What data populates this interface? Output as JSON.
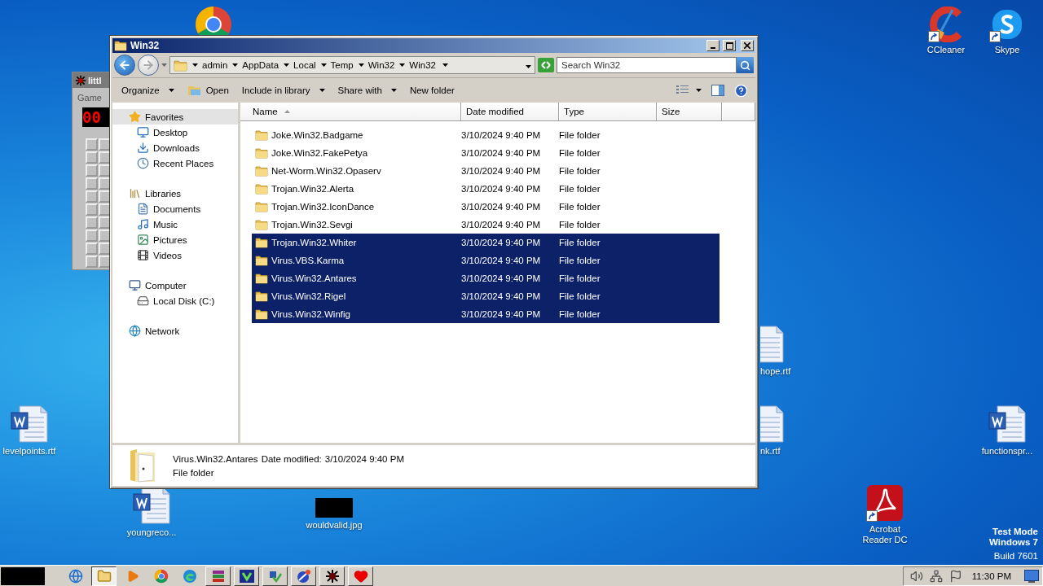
{
  "desktop_icons": [
    {
      "kind": "chrome"
    },
    {
      "label": "CCleaner",
      "kind": "ccleaner",
      "shortcut": true
    },
    {
      "label": "Skype",
      "kind": "skype",
      "shortcut": true
    },
    {
      "label": "levelpoints.rtf",
      "kind": "word"
    },
    {
      "label": "youngreco...",
      "kind": "word"
    },
    {
      "label": "wouldvalid.jpg",
      "kind": "image"
    },
    {
      "label": "hope.rtf",
      "kind": "word-partial"
    },
    {
      "label": "nk.rtf",
      "kind": "word-partial"
    },
    {
      "label": "functionspr...",
      "kind": "word"
    },
    {
      "label": "Acrobat Reader DC",
      "kind": "acrobat",
      "shortcut": true
    }
  ],
  "background_window": {
    "title": "littl",
    "menu": [
      "Game"
    ],
    "counter": "00"
  },
  "explorer": {
    "title": "Win32",
    "breadcrumb": [
      "admin",
      "AppData",
      "Local",
      "Temp",
      "Win32",
      "Win32"
    ],
    "search": {
      "placeholder": "Search Win32"
    },
    "toolbar": [
      {
        "label": "Organize",
        "kind": "menu"
      },
      {
        "label": "Open",
        "kind": "open"
      },
      {
        "label": "Include in library",
        "kind": "menu"
      },
      {
        "label": "Share with",
        "kind": "menu"
      },
      {
        "label": "New folder",
        "kind": "plain"
      }
    ],
    "nav": [
      {
        "label": "Favorites",
        "kind": "star",
        "selected": true,
        "children": [
          {
            "label": "Desktop",
            "kind": "desktop",
            "selected": false
          },
          {
            "label": "Downloads",
            "kind": "downloads",
            "selected": false
          },
          {
            "label": "Recent Places",
            "kind": "recent",
            "selected": false
          }
        ]
      },
      {
        "label": "Libraries",
        "kind": "library",
        "selected": false,
        "children": [
          {
            "label": "Documents",
            "kind": "documents",
            "selected": false
          },
          {
            "label": "Music",
            "kind": "music",
            "selected": false
          },
          {
            "label": "Pictures",
            "kind": "pictures",
            "selected": false
          },
          {
            "label": "Videos",
            "kind": "videos",
            "selected": false
          }
        ]
      },
      {
        "label": "Computer",
        "kind": "computer",
        "selected": false,
        "children": [
          {
            "label": "Local Disk (C:)",
            "kind": "disk",
            "selected": false
          }
        ]
      },
      {
        "label": "Network",
        "kind": "network",
        "selected": false
      }
    ],
    "columns": [
      "Name",
      "Date modified",
      "Type",
      "Size"
    ],
    "rows": [
      {
        "name": "Joke.Win32.Badgame",
        "date": "3/10/2024 9:40 PM",
        "type": "File folder",
        "selected": false
      },
      {
        "name": "Joke.Win32.FakePetya",
        "date": "3/10/2024 9:40 PM",
        "type": "File folder",
        "selected": false
      },
      {
        "name": "Net-Worm.Win32.Opaserv",
        "date": "3/10/2024 9:40 PM",
        "type": "File folder",
        "selected": false
      },
      {
        "name": "Trojan.Win32.Alerta",
        "date": "3/10/2024 9:40 PM",
        "type": "File folder",
        "selected": false
      },
      {
        "name": "Trojan.Win32.IconDance",
        "date": "3/10/2024 9:40 PM",
        "type": "File folder",
        "selected": false
      },
      {
        "name": "Trojan.Win32.Sevgi",
        "date": "3/10/2024 9:40 PM",
        "type": "File folder",
        "selected": false
      },
      {
        "name": "Trojan.Win32.Whiter",
        "date": "3/10/2024 9:40 PM",
        "type": "File folder",
        "selected": true
      },
      {
        "name": "Virus.VBS.Karma",
        "date": "3/10/2024 9:40 PM",
        "type": "File folder",
        "selected": true
      },
      {
        "name": "Virus.Win32.Antares",
        "date": "3/10/2024 9:40 PM",
        "type": "File folder",
        "selected": true
      },
      {
        "name": "Virus.Win32.Rigel",
        "date": "3/10/2024 9:40 PM",
        "type": "File folder",
        "selected": true
      },
      {
        "name": "Virus.Win32.Winfig",
        "date": "3/10/2024 9:40 PM",
        "type": "File folder",
        "selected": true
      }
    ],
    "details": {
      "name": "Virus.Win32.Antares",
      "date_label": "Date modified:",
      "date": "3/10/2024 9:40 PM",
      "type": "File folder"
    }
  },
  "system_notice": [
    "Test Mode",
    "Windows 7",
    "Build 7601"
  ],
  "taskbar": {
    "items": [
      {
        "kind": "ie",
        "running": false,
        "selected": false
      },
      {
        "kind": "explorer",
        "running": true,
        "selected": true
      },
      {
        "kind": "media",
        "running": false,
        "selected": false
      },
      {
        "kind": "chrome",
        "running": false,
        "selected": false
      },
      {
        "kind": "edge",
        "running": false,
        "selected": false
      },
      {
        "kind": "winrar",
        "running": true,
        "selected": false
      },
      {
        "kind": "setup",
        "running": true,
        "selected": false
      },
      {
        "kind": "tool",
        "running": true,
        "selected": false
      },
      {
        "kind": "globe",
        "running": true,
        "selected": false
      },
      {
        "kind": "mine",
        "running": true,
        "selected": false
      },
      {
        "kind": "heart",
        "running": true,
        "selected": false
      }
    ],
    "clock": "11:30 PM"
  }
}
